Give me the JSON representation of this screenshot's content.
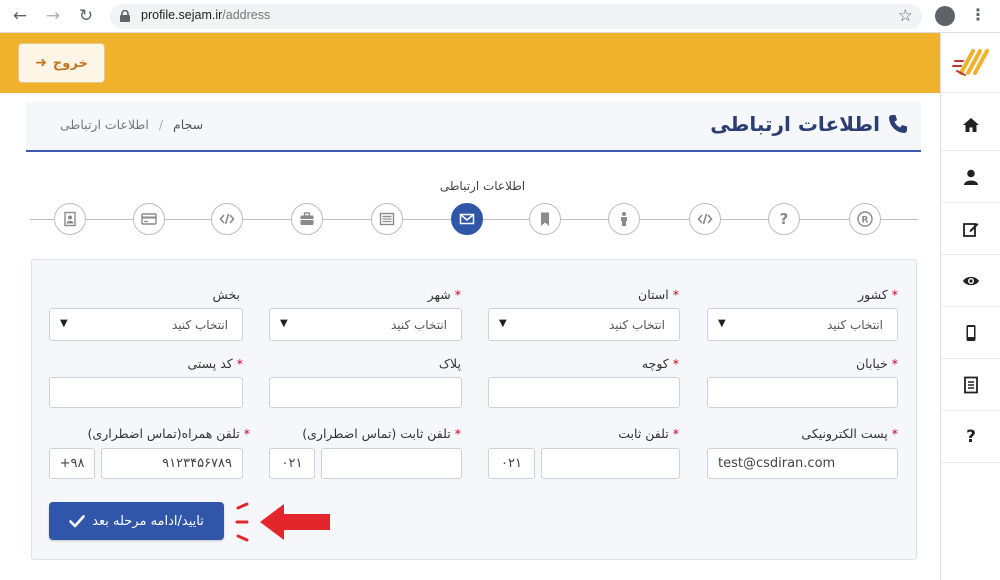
{
  "browser": {
    "url_host": "profile.sejam.ir",
    "url_path": "/address"
  },
  "header": {
    "logout_label": "خروج",
    "logout_icon": "sign-out-icon"
  },
  "sidebar": {
    "items": [
      {
        "name": "home-icon"
      },
      {
        "name": "user-icon"
      },
      {
        "name": "edit-icon"
      },
      {
        "name": "eye-icon"
      },
      {
        "name": "mobile-icon"
      },
      {
        "name": "document-icon"
      },
      {
        "name": "question-icon"
      }
    ]
  },
  "page": {
    "title": "اطلاعات ارتباطی",
    "breadcrumb_home": "سجام",
    "breadcrumb_sep": "/",
    "breadcrumb_current": "اطلاعات ارتباطی"
  },
  "stepper": {
    "active_caption": "اطلاعات ارتباطی",
    "steps": [
      {
        "icon": "registered-icon"
      },
      {
        "icon": "question-icon",
        "glyph": "?"
      },
      {
        "icon": "code-icon"
      },
      {
        "icon": "person-icon"
      },
      {
        "icon": "bookmark-icon"
      },
      {
        "icon": "envelope-icon",
        "active": true
      },
      {
        "icon": "newspaper-icon"
      },
      {
        "icon": "briefcase-icon"
      },
      {
        "icon": "code-icon"
      },
      {
        "icon": "credit-card-icon"
      },
      {
        "icon": "id-card-icon"
      }
    ]
  },
  "form": {
    "country": {
      "label": "کشور",
      "required": true,
      "value": "انتخاب کنید"
    },
    "province": {
      "label": "استان",
      "required": true,
      "value": "انتخاب کنید"
    },
    "city": {
      "label": "شهر",
      "required": true,
      "value": "انتخاب کنید"
    },
    "district": {
      "label": "بخش",
      "required": false,
      "value": "انتخاب کنید"
    },
    "street": {
      "label": "خیابان",
      "required": true,
      "value": ""
    },
    "alley": {
      "label": "کوچه",
      "required": true,
      "value": ""
    },
    "plaque": {
      "label": "پلاک",
      "required": false,
      "value": ""
    },
    "postal_code": {
      "label": "کد پستی",
      "required": true,
      "value": ""
    },
    "email": {
      "label": "پست الکترونیکی",
      "required": true,
      "value": "test@csdiran.com"
    },
    "phone": {
      "label": "تلفن ثابت",
      "required": true,
      "prefix": "۰۲۱",
      "value": ""
    },
    "emergency_phone": {
      "label": "تلفن ثابت (تماس اضطراری)",
      "required": true,
      "prefix": "۰۲۱",
      "value": ""
    },
    "emergency_mobile": {
      "label": "تلفن همراه(تماس اضطراری)",
      "required": true,
      "prefix": "+۹۸",
      "value": "۹۱۲۳۴۵۶۷۸۹"
    },
    "submit_label": "تایید/ادامه مرحله بعد"
  },
  "colors": {
    "brand_yellow": "#f0b12d",
    "primary_blue": "#2f56a8",
    "required_red": "#d0021b",
    "annotation_red": "#e3262b"
  }
}
